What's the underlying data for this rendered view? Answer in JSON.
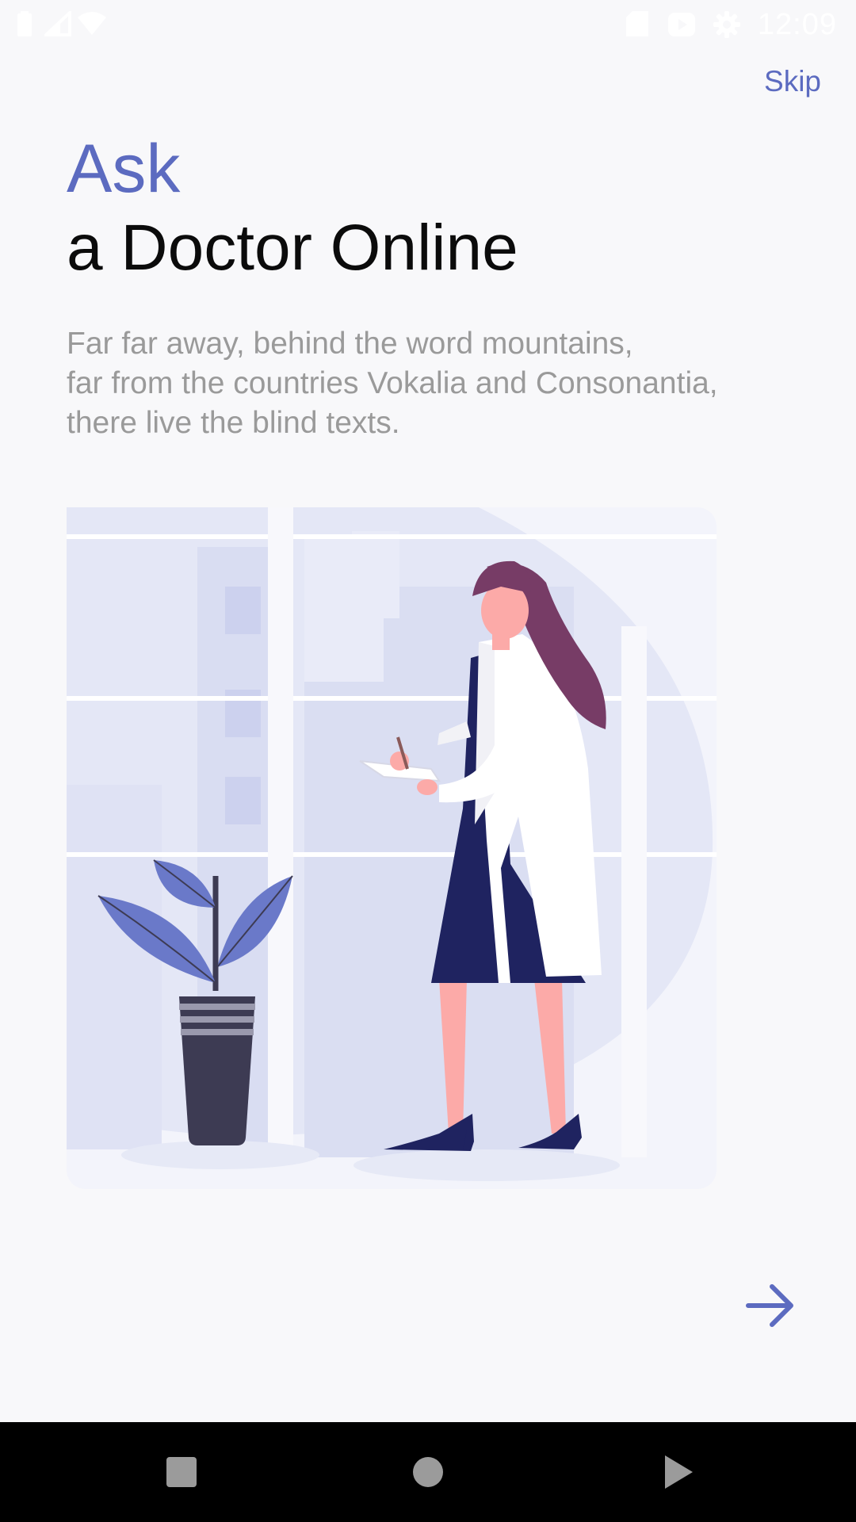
{
  "status_bar": {
    "time": "12:09",
    "left_icons": [
      "battery-icon",
      "signal-icon",
      "wifi-icon"
    ],
    "right_icons": [
      "sd-card-icon",
      "play-store-icon",
      "settings-gear-icon"
    ]
  },
  "onboarding": {
    "skip_label": "Skip",
    "title_accent": "Ask",
    "title_main": "a Doctor Online",
    "description_lines": [
      "Far far away, behind the word mountains,",
      "far from the countries Vokalia and Consonantia,",
      "there live the blind texts."
    ],
    "illustration": "doctor-with-clipboard-illustration",
    "next_icon": "arrow-right-icon"
  },
  "nav_bar": {
    "buttons": [
      "square-recents-icon",
      "circle-home-icon",
      "triangle-back-icon"
    ]
  },
  "colors": {
    "accent": "#5c6bc0",
    "title": "#0b0b0b",
    "body_text": "#9a9a9a",
    "background": "#f8f8fa",
    "nav_bar": "#000000"
  }
}
